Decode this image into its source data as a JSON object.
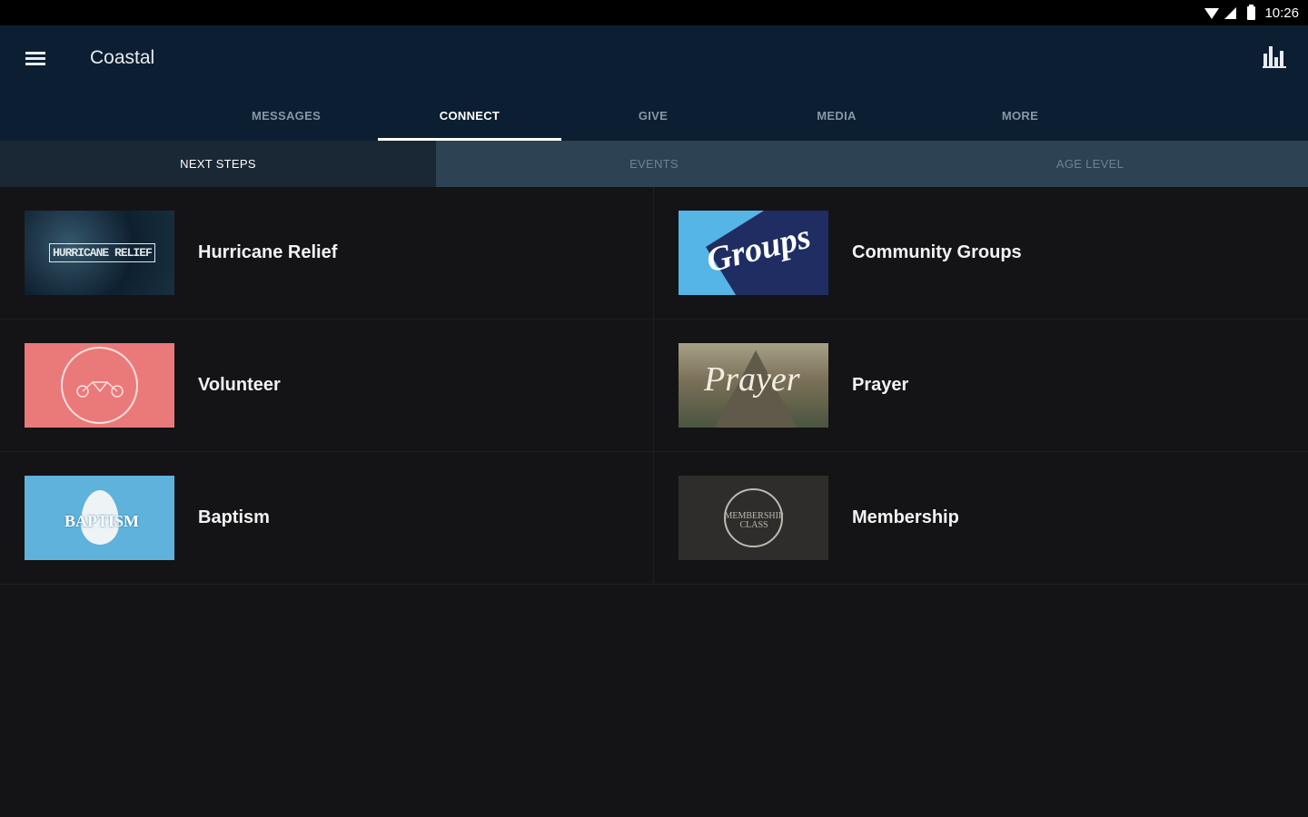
{
  "status_bar": {
    "time": "10:26"
  },
  "app_bar": {
    "title": "Coastal"
  },
  "main_tabs": [
    {
      "label": "MESSAGES"
    },
    {
      "label": "CONNECT"
    },
    {
      "label": "GIVE"
    },
    {
      "label": "MEDIA"
    },
    {
      "label": "MORE"
    }
  ],
  "active_main_tab": "CONNECT",
  "sub_tabs": [
    {
      "label": "NEXT STEPS"
    },
    {
      "label": "EVENTS"
    },
    {
      "label": "AGE LEVEL"
    }
  ],
  "active_sub_tab": "NEXT STEPS",
  "items": [
    {
      "label": "Hurricane Relief",
      "thumb_text": "HURRICANE RELIEF"
    },
    {
      "label": "Community Groups",
      "thumb_text": "Groups"
    },
    {
      "label": "Volunteer",
      "thumb_text": ""
    },
    {
      "label": "Prayer",
      "thumb_text": "Prayer"
    },
    {
      "label": "Baptism",
      "thumb_text": "BAPTISM"
    },
    {
      "label": "Membership",
      "thumb_text": "MEMBERSHIP CLASS"
    }
  ],
  "colors": {
    "app_bar": "#0c1e31",
    "background": "#141416",
    "sub_tab_bar": "#2d4353",
    "sub_tab_active": "#1a2835"
  },
  "icons": {
    "menu": "hamburger-menu-icon",
    "stats": "bar-chart-icon",
    "wifi": "wifi-icon",
    "signal": "cell-signal-icon",
    "battery": "battery-icon"
  }
}
